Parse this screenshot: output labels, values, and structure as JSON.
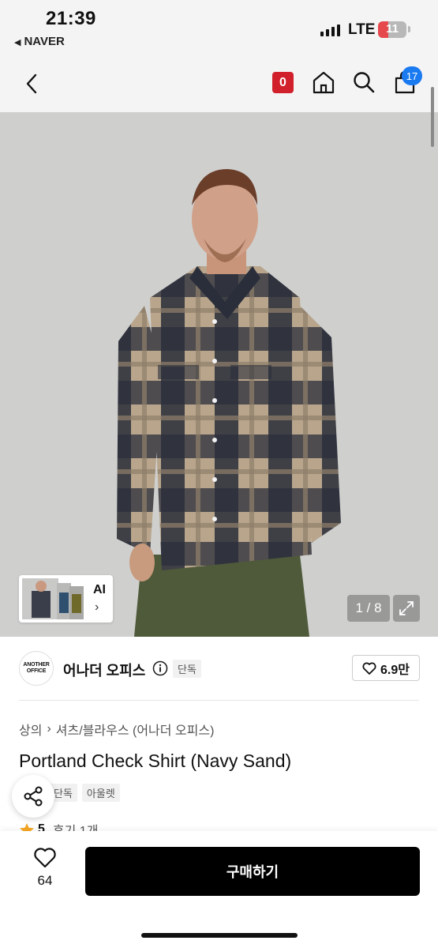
{
  "status_bar": {
    "time": "21:39",
    "back_app": "NAVER",
    "network": "LTE",
    "battery": "11",
    "battery_level": 0.11
  },
  "header": {
    "event_badge": "0",
    "cart_count": "17"
  },
  "gallery": {
    "ai_label": "AI",
    "pager": "1 / 8"
  },
  "brand": {
    "logo_line1": "ANOTHER",
    "logo_line2": "OFFICE",
    "name": "어나더 오피스",
    "exclusive_tag": "단독",
    "likes": "6.9만"
  },
  "product": {
    "breadcrumb": [
      "상의",
      "셔츠/블라우스 (어나더 오피스)"
    ],
    "title": "Portland Check Shirt (Navy Sand)",
    "tags": [
      "단독",
      "아울렛"
    ],
    "rating": "5",
    "reviews": "후기 1개"
  },
  "bottom": {
    "wish_count": "64",
    "buy_label": "구매하기"
  },
  "colors": {
    "accent_red": "#d11f2b",
    "accent_blue": "#1a7af0",
    "button": "#000000"
  }
}
